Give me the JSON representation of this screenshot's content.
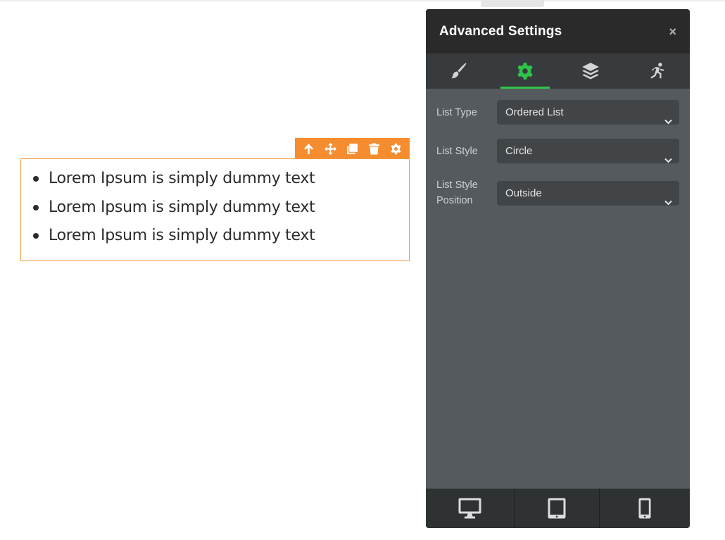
{
  "canvas": {
    "toolbar": {
      "icons": [
        "arrow-up-icon",
        "move-icon",
        "duplicate-icon",
        "trash-icon",
        "gear-icon"
      ],
      "color": "#f58d30"
    },
    "list_items": [
      "Lorem Ipsum is simply dummy text",
      "Lorem Ipsum is simply dummy text",
      "Lorem Ipsum is simply dummy text"
    ]
  },
  "panel": {
    "title": "Advanced Settings",
    "close_label": "×",
    "tabs": [
      {
        "icon": "brush-icon",
        "active": false
      },
      {
        "icon": "gear-icon",
        "active": true
      },
      {
        "icon": "layers-icon",
        "active": false
      },
      {
        "icon": "animation-icon",
        "active": false
      }
    ],
    "accent_color": "#2ec34b",
    "fields": [
      {
        "label": "List Type",
        "value": "Ordered List"
      },
      {
        "label": "List Style",
        "value": "Circle"
      },
      {
        "label": "List Style Position",
        "value": "Outside"
      }
    ],
    "devices": [
      {
        "icon": "desktop-icon"
      },
      {
        "icon": "tablet-icon"
      },
      {
        "icon": "mobile-icon"
      }
    ]
  }
}
